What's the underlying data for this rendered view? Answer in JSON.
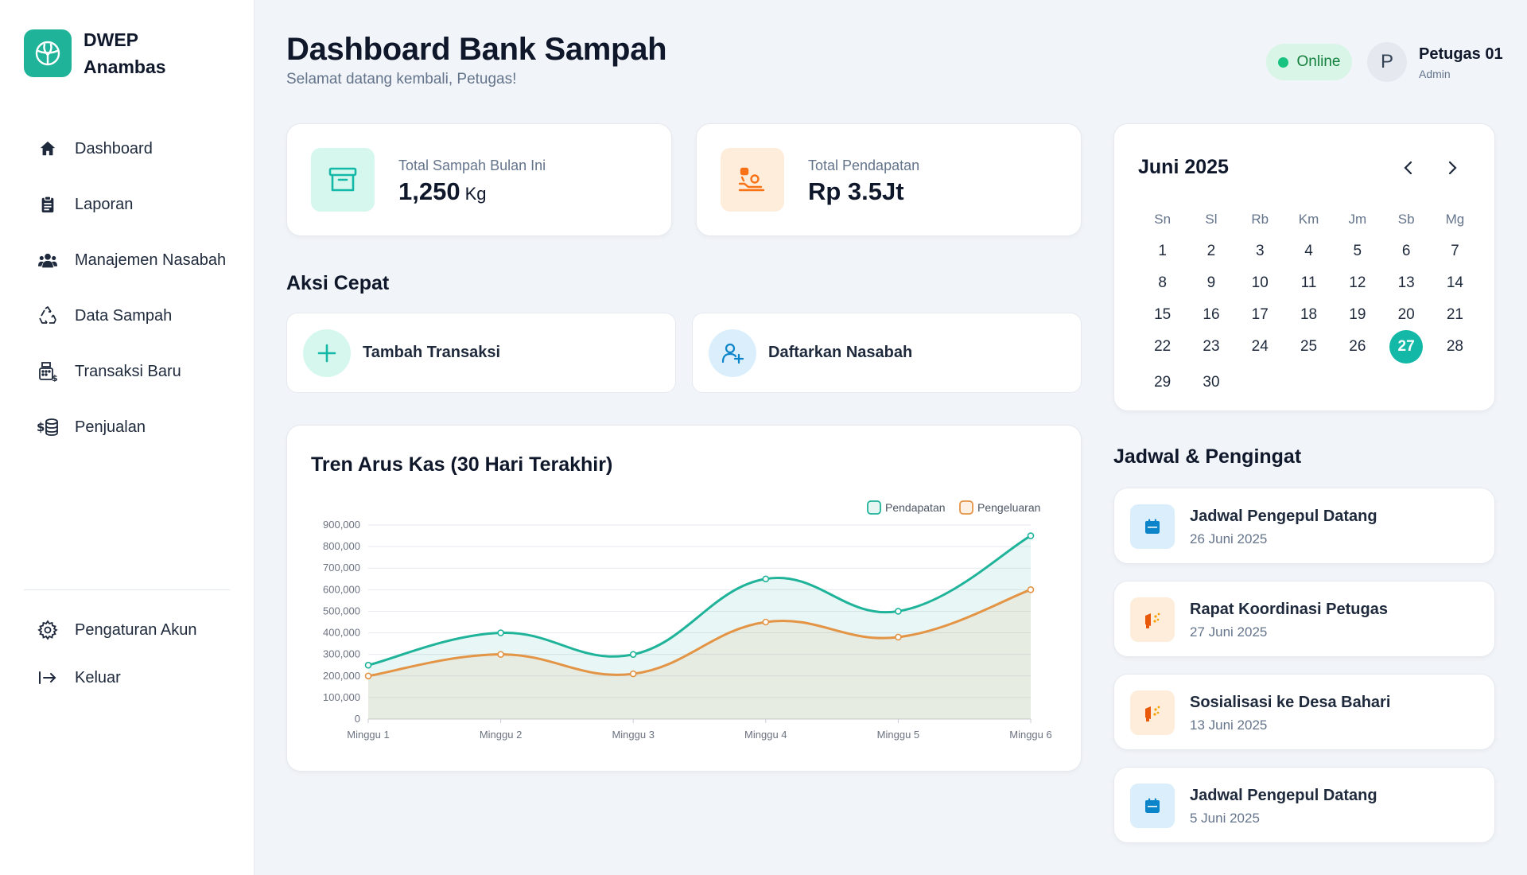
{
  "brand": {
    "line1": "DWEP",
    "line2": "Anambas",
    "icon": "leaf-logo-icon"
  },
  "sidebar": {
    "items": [
      {
        "label": "Dashboard",
        "icon": "home-icon"
      },
      {
        "label": "Laporan",
        "icon": "clipboard-icon"
      },
      {
        "label": "Manajemen Nasabah",
        "icon": "users-icon"
      },
      {
        "label": "Data Sampah",
        "icon": "recycle-icon"
      },
      {
        "label": "Transaksi Baru",
        "icon": "cash-register-icon"
      },
      {
        "label": "Penjualan",
        "icon": "coins-icon"
      }
    ],
    "bottom": [
      {
        "label": "Pengaturan Akun",
        "icon": "gear-icon"
      },
      {
        "label": "Keluar",
        "icon": "logout-icon"
      }
    ]
  },
  "header": {
    "title": "Dashboard Bank Sampah",
    "subtitle": "Selamat datang kembali, Petugas!",
    "status": "Online",
    "avatar_initial": "P",
    "user_name": "Petugas 01",
    "user_role": "Admin"
  },
  "stats": [
    {
      "label": "Total Sampah Bulan Ini",
      "value": "1,250",
      "unit": "Kg",
      "icon": "archive-box-icon",
      "color": "#14b8a6"
    },
    {
      "label": "Total Pendapatan",
      "value": "Rp 3.5Jt",
      "unit": "",
      "icon": "money-hand-icon",
      "color": "#f97316"
    }
  ],
  "quick_actions": {
    "title": "Aksi Cepat",
    "items": [
      {
        "label": "Tambah Transaksi",
        "icon": "plus-icon"
      },
      {
        "label": "Daftarkan Nasabah",
        "icon": "user-plus-icon"
      }
    ]
  },
  "chart_data": {
    "type": "line",
    "title": "Tren Arus Kas (30 Hari Terakhir)",
    "x": [
      "Minggu 1",
      "Minggu 2",
      "Minggu 3",
      "Minggu 4",
      "Minggu 5",
      "Minggu 6"
    ],
    "y_ticks": [
      "0",
      "100,000",
      "200,000",
      "300,000",
      "400,000",
      "500,000",
      "600,000",
      "700,000",
      "800,000",
      "900,000"
    ],
    "ylim": [
      0,
      900000
    ],
    "grid": true,
    "legend_position": "top-right",
    "series": [
      {
        "name": "Pendapatan",
        "values": [
          250000,
          400000,
          300000,
          650000,
          500000,
          850000
        ],
        "color": "#1fb39a"
      },
      {
        "name": "Pengeluaran",
        "values": [
          200000,
          300000,
          210000,
          450000,
          380000,
          600000
        ],
        "color": "#e39445"
      }
    ]
  },
  "calendar": {
    "title": "Juni 2025",
    "weekdays": [
      "Sn",
      "Sl",
      "Rb",
      "Km",
      "Jm",
      "Sb",
      "Mg"
    ],
    "weeks": [
      [
        "1",
        "2",
        "3",
        "4",
        "5",
        "6",
        "7"
      ],
      [
        "8",
        "9",
        "10",
        "11",
        "12",
        "13",
        "14"
      ],
      [
        "15",
        "16",
        "17",
        "18",
        "19",
        "20",
        "21"
      ],
      [
        "22",
        "23",
        "24",
        "25",
        "26",
        "27",
        "28"
      ],
      [
        "29",
        "30",
        "",
        "",
        "",
        "",
        ""
      ]
    ],
    "today": "27"
  },
  "schedule": {
    "title": "Jadwal & Pengingat",
    "items": [
      {
        "title": "Jadwal Pengepul Datang",
        "date": "26 Juni 2025",
        "icon": "calendar-icon",
        "kind": "blue"
      },
      {
        "title": "Rapat Koordinasi Petugas",
        "date": "27 Juni 2025",
        "icon": "megaphone-icon",
        "kind": "orange"
      },
      {
        "title": "Sosialisasi ke Desa Bahari",
        "date": "13 Juni 2025",
        "icon": "megaphone-icon",
        "kind": "orange"
      },
      {
        "title": "Jadwal Pengepul Datang",
        "date": "5 Juni 2025",
        "icon": "calendar-icon",
        "kind": "blue"
      }
    ]
  }
}
